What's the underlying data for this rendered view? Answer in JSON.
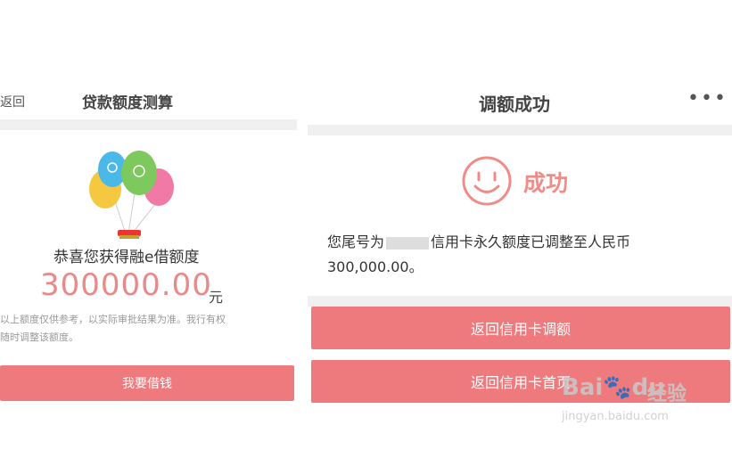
{
  "left": {
    "back_label": "返回",
    "title": "贷款额度测算",
    "congrats_text": "恭喜您获得融e借额度",
    "amount": "300000.00",
    "unit": "元",
    "disclaimer_line1": "以上额度仅供参考，以实际审批结果为准。我行有权",
    "disclaimer_line2": "随时调整该额度。",
    "borrow_button": "我要借钱"
  },
  "right": {
    "title": "调额成功",
    "more_icon": "•••",
    "status_text": "成功",
    "message_prefix": "您尾号为",
    "message_suffix": "信用卡永久额度已调整至人民币 300,000.00。",
    "button_back_adjust": "返回信用卡调额",
    "button_back_home": "返回信用卡首页"
  },
  "watermark": {
    "logo_text": "Bai",
    "logo_text2": "du",
    "brand_cn": "经验",
    "url": "jingyan.baidu.com"
  },
  "colors": {
    "accent": "#ef7a7d",
    "success_pink": "#f08c88",
    "amount_pink": "#e98a8a"
  }
}
